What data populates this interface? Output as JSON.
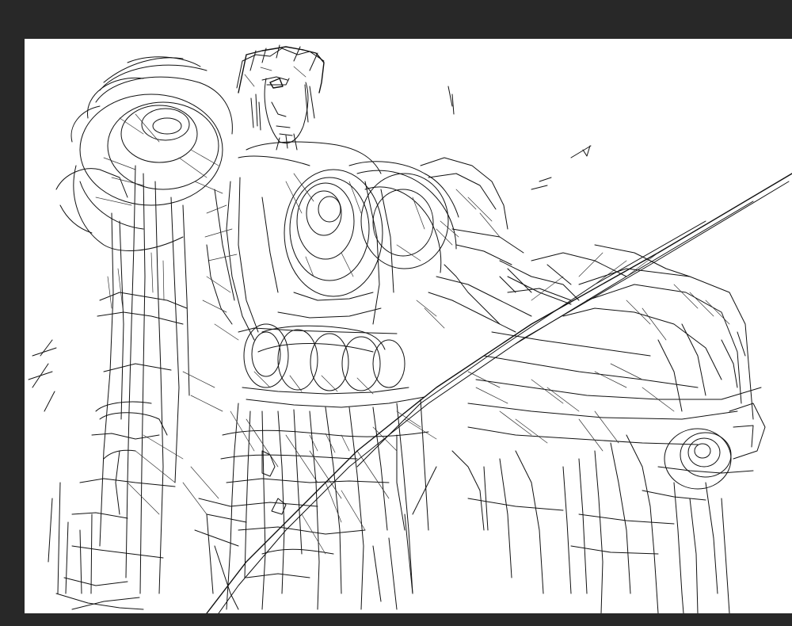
{
  "colors": {
    "workspace_background": "#282828",
    "canvas_background": "#ffffff",
    "ink": "#111111"
  },
  "canvas": {
    "content": "rough-line-sketch",
    "icon": "sketch-artwork"
  }
}
